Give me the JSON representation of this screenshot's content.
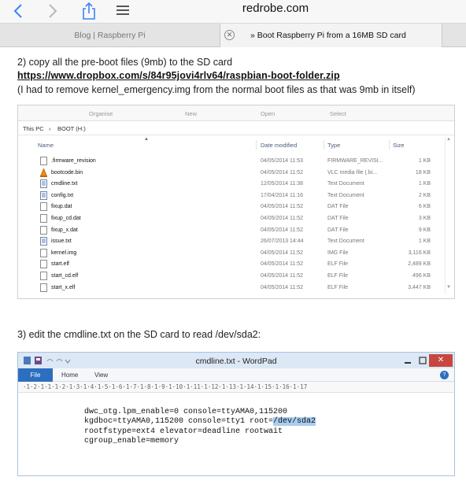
{
  "browser": {
    "url": "redrobe.com",
    "tabs": [
      {
        "label": "Blog | Raspberry Pi"
      },
      {
        "label": "» Boot Raspberry Pi from a 16MB SD card"
      }
    ]
  },
  "article": {
    "step2": "2) copy all the pre-boot files (9mb) to the SD card",
    "link": "https://www.dropbox.com/s/84r95jovi4rlv64/raspbian-boot-folder.zip",
    "note": "(I had to remove kernel_emergency.img from the normal boot files as that was 9mb in itself)",
    "step3": "3) edit the cmdline.txt on the SD card to read /dev/sda2:"
  },
  "explorer": {
    "ribbon": [
      "Organise",
      "New",
      "Open",
      "Select"
    ],
    "breadcrumb": {
      "root": "This PC",
      "separator": "›",
      "current": "BOOT (H:)"
    },
    "columns": {
      "name": "Name",
      "date": "Date modified",
      "type": "Type",
      "size": "Size"
    },
    "files": [
      {
        "name": ".firmware_revision",
        "date": "04/05/2014 11:53",
        "type": "FIRMWARE_REVISI...",
        "size": "1 KB",
        "icon": "document-icon"
      },
      {
        "name": "bootcode.bin",
        "date": "04/05/2014 11:52",
        "type": "VLC media file (.bi...",
        "size": "18 KB",
        "icon": "vlc-icon"
      },
      {
        "name": "cmdline.txt",
        "date": "12/05/2014 11:38",
        "type": "Text Document",
        "size": "1 KB",
        "icon": "text-icon"
      },
      {
        "name": "config.txt",
        "date": "17/04/2014 11:16",
        "type": "Text Document",
        "size": "2 KB",
        "icon": "text-icon"
      },
      {
        "name": "fixup.dat",
        "date": "04/05/2014 11:52",
        "type": "DAT File",
        "size": "6 KB",
        "icon": "document-icon"
      },
      {
        "name": "fixup_cd.dat",
        "date": "04/05/2014 11:52",
        "type": "DAT File",
        "size": "3 KB",
        "icon": "document-icon"
      },
      {
        "name": "fixup_x.dat",
        "date": "04/05/2014 11:52",
        "type": "DAT File",
        "size": "9 KB",
        "icon": "document-icon"
      },
      {
        "name": "issue.txt",
        "date": "26/07/2013 14:44",
        "type": "Text Document",
        "size": "1 KB",
        "icon": "text-icon"
      },
      {
        "name": "kernel.img",
        "date": "04/05/2014 11:52",
        "type": "IMG File",
        "size": "3,116 KB",
        "icon": "document-icon"
      },
      {
        "name": "start.elf",
        "date": "04/05/2014 11:52",
        "type": "ELF File",
        "size": "2,489 KB",
        "icon": "document-icon"
      },
      {
        "name": "start_cd.elf",
        "date": "04/05/2014 11:52",
        "type": "ELF File",
        "size": "496 KB",
        "icon": "document-icon"
      },
      {
        "name": "start_x.elf",
        "date": "04/05/2014 11:52",
        "type": "ELF File",
        "size": "3,447 KB",
        "icon": "document-icon"
      }
    ]
  },
  "wordpad": {
    "title": "cmdline.txt - WordPad",
    "menu": {
      "file": "File",
      "home": "Home",
      "view": "View"
    },
    "ruler": "·1·2·1·1·1·2·1·3·1·4·1·5·1·6·1·7·1·8·1·9·1·10·1·11·1·12·1·13·1·14·1·15·1·16·1·17",
    "lines": {
      "l1": "dwc_otg.lpm_enable=0 console=ttyAMA0,115200",
      "l2_before": "kgdboc=ttyAMA0,115200 console=tty1 root=",
      "l2_highlight": "/dev/sda2",
      "l3": "rootfstype=ext4 elevator=deadline rootwait",
      "l4": "cgroup_enable=memory"
    },
    "highlight_color": "#a9cdf0"
  }
}
